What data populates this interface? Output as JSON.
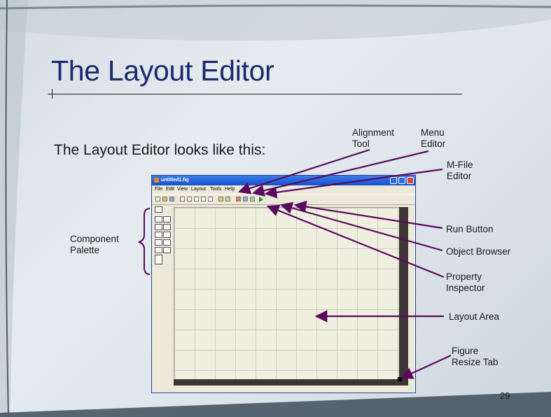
{
  "slide": {
    "title": "The Layout Editor",
    "subtitle": "The Layout Editor looks like this:",
    "page_number": "29"
  },
  "window": {
    "title": "untitled1.fig",
    "menus": [
      "File",
      "Edit",
      "View",
      "Layout",
      "Tools",
      "Help"
    ]
  },
  "callouts": {
    "alignment_tool": [
      "Alignment",
      "Tool"
    ],
    "menu_editor": [
      "Menu",
      "Editor"
    ],
    "mfile_editor": [
      "M-File",
      "Editor"
    ],
    "component_palette": [
      "Component",
      "Palette"
    ],
    "run_button": "Run Button",
    "object_browser": "Object Browser",
    "property_inspector": [
      "Property",
      "Inspector"
    ],
    "layout_area": "Layout Area",
    "figure_resize_tab": [
      "Figure",
      "Resize Tab"
    ]
  },
  "colors": {
    "title": "#1b2a6e",
    "arrows": "#5a0a5e",
    "titlebar": "#1651cf"
  }
}
